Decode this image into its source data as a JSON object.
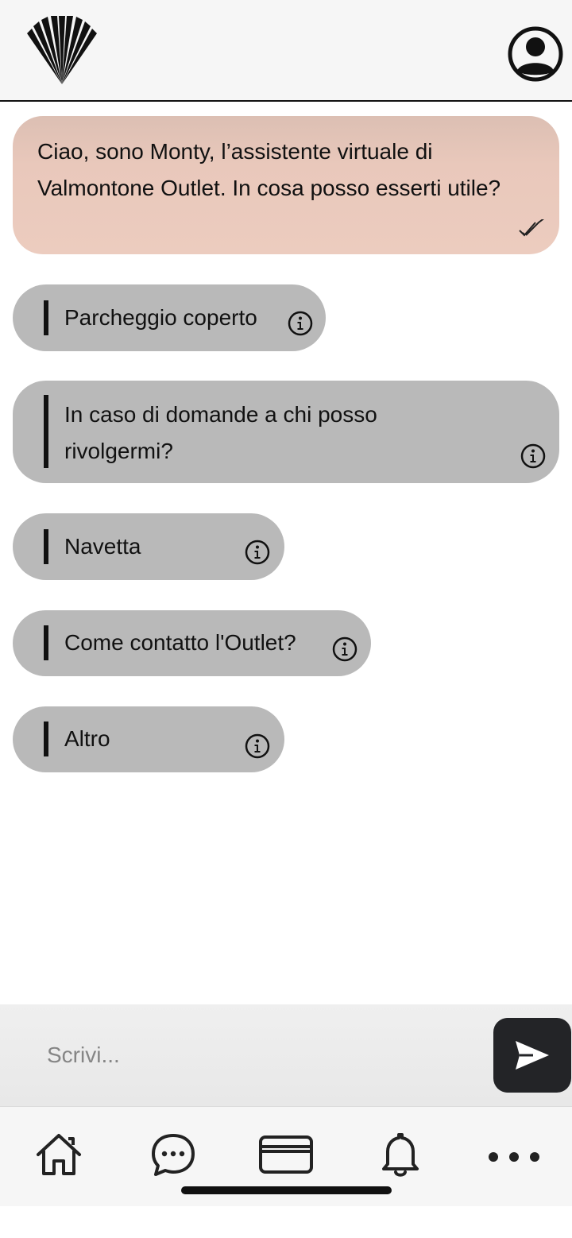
{
  "header": {
    "logo_icon": "valmontone-logo-icon",
    "profile_icon": "user-profile-icon"
  },
  "chat": {
    "bot_message": "Ciao, sono Monty, l’assistente virtuale di Valmontone Outlet. In cosa posso esserti utile?",
    "read_status_icon": "double-check-icon",
    "options": [
      {
        "label": "Parcheggio coperto",
        "icon": "info-icon"
      },
      {
        "label": "In caso di domande a chi posso rivolgermi?",
        "icon": "info-icon"
      },
      {
        "label": "Navetta",
        "icon": "info-icon"
      },
      {
        "label": "Come contatto l'Outlet?",
        "icon": "info-icon"
      },
      {
        "label": "Altro",
        "icon": "info-icon"
      }
    ]
  },
  "input": {
    "placeholder": "Scrivi...",
    "value": "",
    "send_icon": "send-arrow-icon"
  },
  "bottom_nav": {
    "items": [
      {
        "icon": "home-icon"
      },
      {
        "icon": "chat-bubble-icon"
      },
      {
        "icon": "card-icon"
      },
      {
        "icon": "bell-icon"
      },
      {
        "icon": "more-dots-icon"
      }
    ]
  },
  "colors": {
    "bot_bubble": "#ecccbf",
    "option_bubble": "#b9b9b9",
    "send_button": "#232427",
    "accent_dark": "#111111"
  }
}
